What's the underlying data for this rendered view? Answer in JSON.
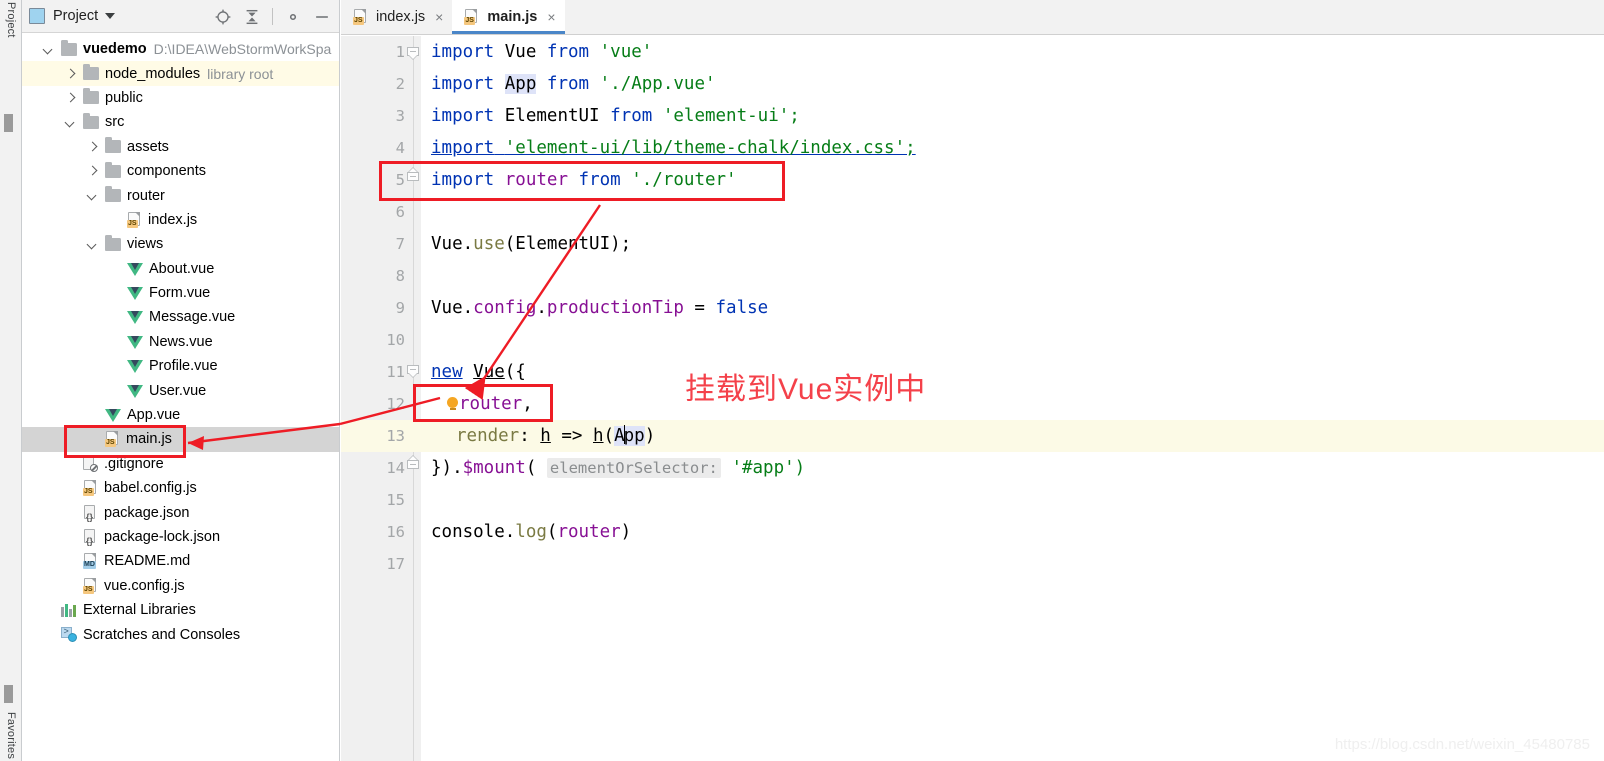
{
  "window": {
    "left_strip_label_top": "Project",
    "left_strip_label_bottom": "Favorites"
  },
  "project_panel": {
    "title": "Project",
    "icon": "project-window-icon",
    "toolbar": [
      {
        "name": "select-opened-file-icon",
        "label": "Select Opened File"
      },
      {
        "name": "collapse-all-icon",
        "label": "Collapse All"
      },
      {
        "name": "settings-gear-icon",
        "label": "Settings"
      },
      {
        "name": "hide-icon",
        "label": "Hide"
      }
    ],
    "tree": [
      {
        "depth": 0,
        "arrow": "down",
        "icon": "folder",
        "label": "vuedemo",
        "bold": true,
        "suffix": "D:\\IDEA\\WebStormWorkSpa",
        "highlight": "none"
      },
      {
        "depth": 1,
        "arrow": "right",
        "icon": "folder",
        "label": "node_modules",
        "suffix": "library root",
        "highlight": "yellow"
      },
      {
        "depth": 1,
        "arrow": "right",
        "icon": "folder",
        "label": "public",
        "suffix": "",
        "highlight": "none"
      },
      {
        "depth": 1,
        "arrow": "down",
        "icon": "folder",
        "label": "src",
        "suffix": "",
        "highlight": "none"
      },
      {
        "depth": 2,
        "arrow": "right",
        "icon": "folder",
        "label": "assets",
        "suffix": "",
        "highlight": "none"
      },
      {
        "depth": 2,
        "arrow": "right",
        "icon": "folder",
        "label": "components",
        "suffix": "",
        "highlight": "none"
      },
      {
        "depth": 2,
        "arrow": "down",
        "icon": "folder",
        "label": "router",
        "suffix": "",
        "highlight": "none"
      },
      {
        "depth": 3,
        "arrow": "none",
        "icon": "js",
        "label": "index.js",
        "suffix": "",
        "highlight": "none"
      },
      {
        "depth": 2,
        "arrow": "down",
        "icon": "folder",
        "label": "views",
        "suffix": "",
        "highlight": "none"
      },
      {
        "depth": 3,
        "arrow": "none",
        "icon": "vue",
        "label": "About.vue",
        "suffix": "",
        "highlight": "none"
      },
      {
        "depth": 3,
        "arrow": "none",
        "icon": "vue",
        "label": "Form.vue",
        "suffix": "",
        "highlight": "none"
      },
      {
        "depth": 3,
        "arrow": "none",
        "icon": "vue",
        "label": "Message.vue",
        "suffix": "",
        "highlight": "none"
      },
      {
        "depth": 3,
        "arrow": "none",
        "icon": "vue",
        "label": "News.vue",
        "suffix": "",
        "highlight": "none"
      },
      {
        "depth": 3,
        "arrow": "none",
        "icon": "vue",
        "label": "Profile.vue",
        "suffix": "",
        "highlight": "none"
      },
      {
        "depth": 3,
        "arrow": "none",
        "icon": "vue",
        "label": "User.vue",
        "suffix": "",
        "highlight": "none"
      },
      {
        "depth": 2,
        "arrow": "none",
        "icon": "vue",
        "label": "App.vue",
        "suffix": "",
        "highlight": "none"
      },
      {
        "depth": 2,
        "arrow": "none",
        "icon": "js",
        "label": "main.js",
        "suffix": "",
        "highlight": "gray"
      },
      {
        "depth": 1,
        "arrow": "none",
        "icon": "git",
        "label": ".gitignore",
        "suffix": "",
        "highlight": "none"
      },
      {
        "depth": 1,
        "arrow": "none",
        "icon": "js",
        "label": "babel.config.js",
        "suffix": "",
        "highlight": "none"
      },
      {
        "depth": 1,
        "arrow": "none",
        "icon": "json",
        "label": "package.json",
        "suffix": "",
        "highlight": "none"
      },
      {
        "depth": 1,
        "arrow": "none",
        "icon": "json",
        "label": "package-lock.json",
        "suffix": "",
        "highlight": "none"
      },
      {
        "depth": 1,
        "arrow": "none",
        "icon": "md",
        "label": "README.md",
        "suffix": "",
        "highlight": "none"
      },
      {
        "depth": 1,
        "arrow": "none",
        "icon": "js",
        "label": "vue.config.js",
        "suffix": "",
        "highlight": "none"
      },
      {
        "depth": 0,
        "arrow": "none",
        "icon": "lib",
        "label": "External Libraries",
        "suffix": "",
        "highlight": "none"
      },
      {
        "depth": 0,
        "arrow": "none",
        "icon": "scratch",
        "label": "Scratches and Consoles",
        "suffix": "",
        "highlight": "none"
      }
    ]
  },
  "editor": {
    "tabs": [
      {
        "label": "index.js",
        "icon": "js-file-icon",
        "active": false,
        "close": "×"
      },
      {
        "label": "main.js",
        "icon": "js-file-icon",
        "active": true,
        "close": "×"
      }
    ],
    "line_numbers": [
      "1",
      "2",
      "3",
      "4",
      "5",
      "6",
      "7",
      "8",
      "9",
      "10",
      "11",
      "12",
      "13",
      "14",
      "15",
      "16",
      "17"
    ],
    "current_line": 13,
    "lines": {
      "1": "import Vue from 'vue'",
      "2": "import App from './App.vue'",
      "3": "import ElementUI from 'element-ui';",
      "4": "import 'element-ui/lib/theme-chalk/index.css';",
      "5": "import router from './router'",
      "6": "",
      "7": "Vue.use(ElementUI);",
      "8": "",
      "9": "Vue.config.productionTip = false",
      "10": "",
      "11": "new Vue({",
      "12": "  router,",
      "13": "  render: h => h(App)",
      "14": "}).$mount( elementOrSelector: '#app')",
      "15": "",
      "16": "console.log(router)",
      "17": ""
    },
    "tokens": {
      "kw_import": "import",
      "kw_from": "from",
      "kw_new": "new",
      "kw_false": "false",
      "ident_vue": "Vue",
      "ident_app": "App",
      "ident_elementui": "ElementUI",
      "ident_router": "router",
      "str_vue": "'vue'",
      "str_appvue": "'./App.vue'",
      "str_elementui": "'element-ui';",
      "str_chalkcss": "'element-ui/lib/theme-chalk/index.css';",
      "str_router": "'./router'",
      "str_app_sel": "'#app')",
      "param_hint": "elementOrSelector:",
      "mount_call": "}).$mount(",
      "console_log": "console.log(router)",
      "render_line": "  render: h => h(App)",
      "vue_use": "Vue.use(ElementUI);",
      "vue_config": "Vue.config.productionTip = false",
      "new_vue": "new Vue({",
      "router_prop": "router,"
    }
  },
  "annotations": {
    "chinese_note": "挂载到Vue实例中",
    "box_color": "#ee1c25",
    "note_color": "#f4414a"
  },
  "watermark": "https://blog.csdn.net/weixin_45480785"
}
